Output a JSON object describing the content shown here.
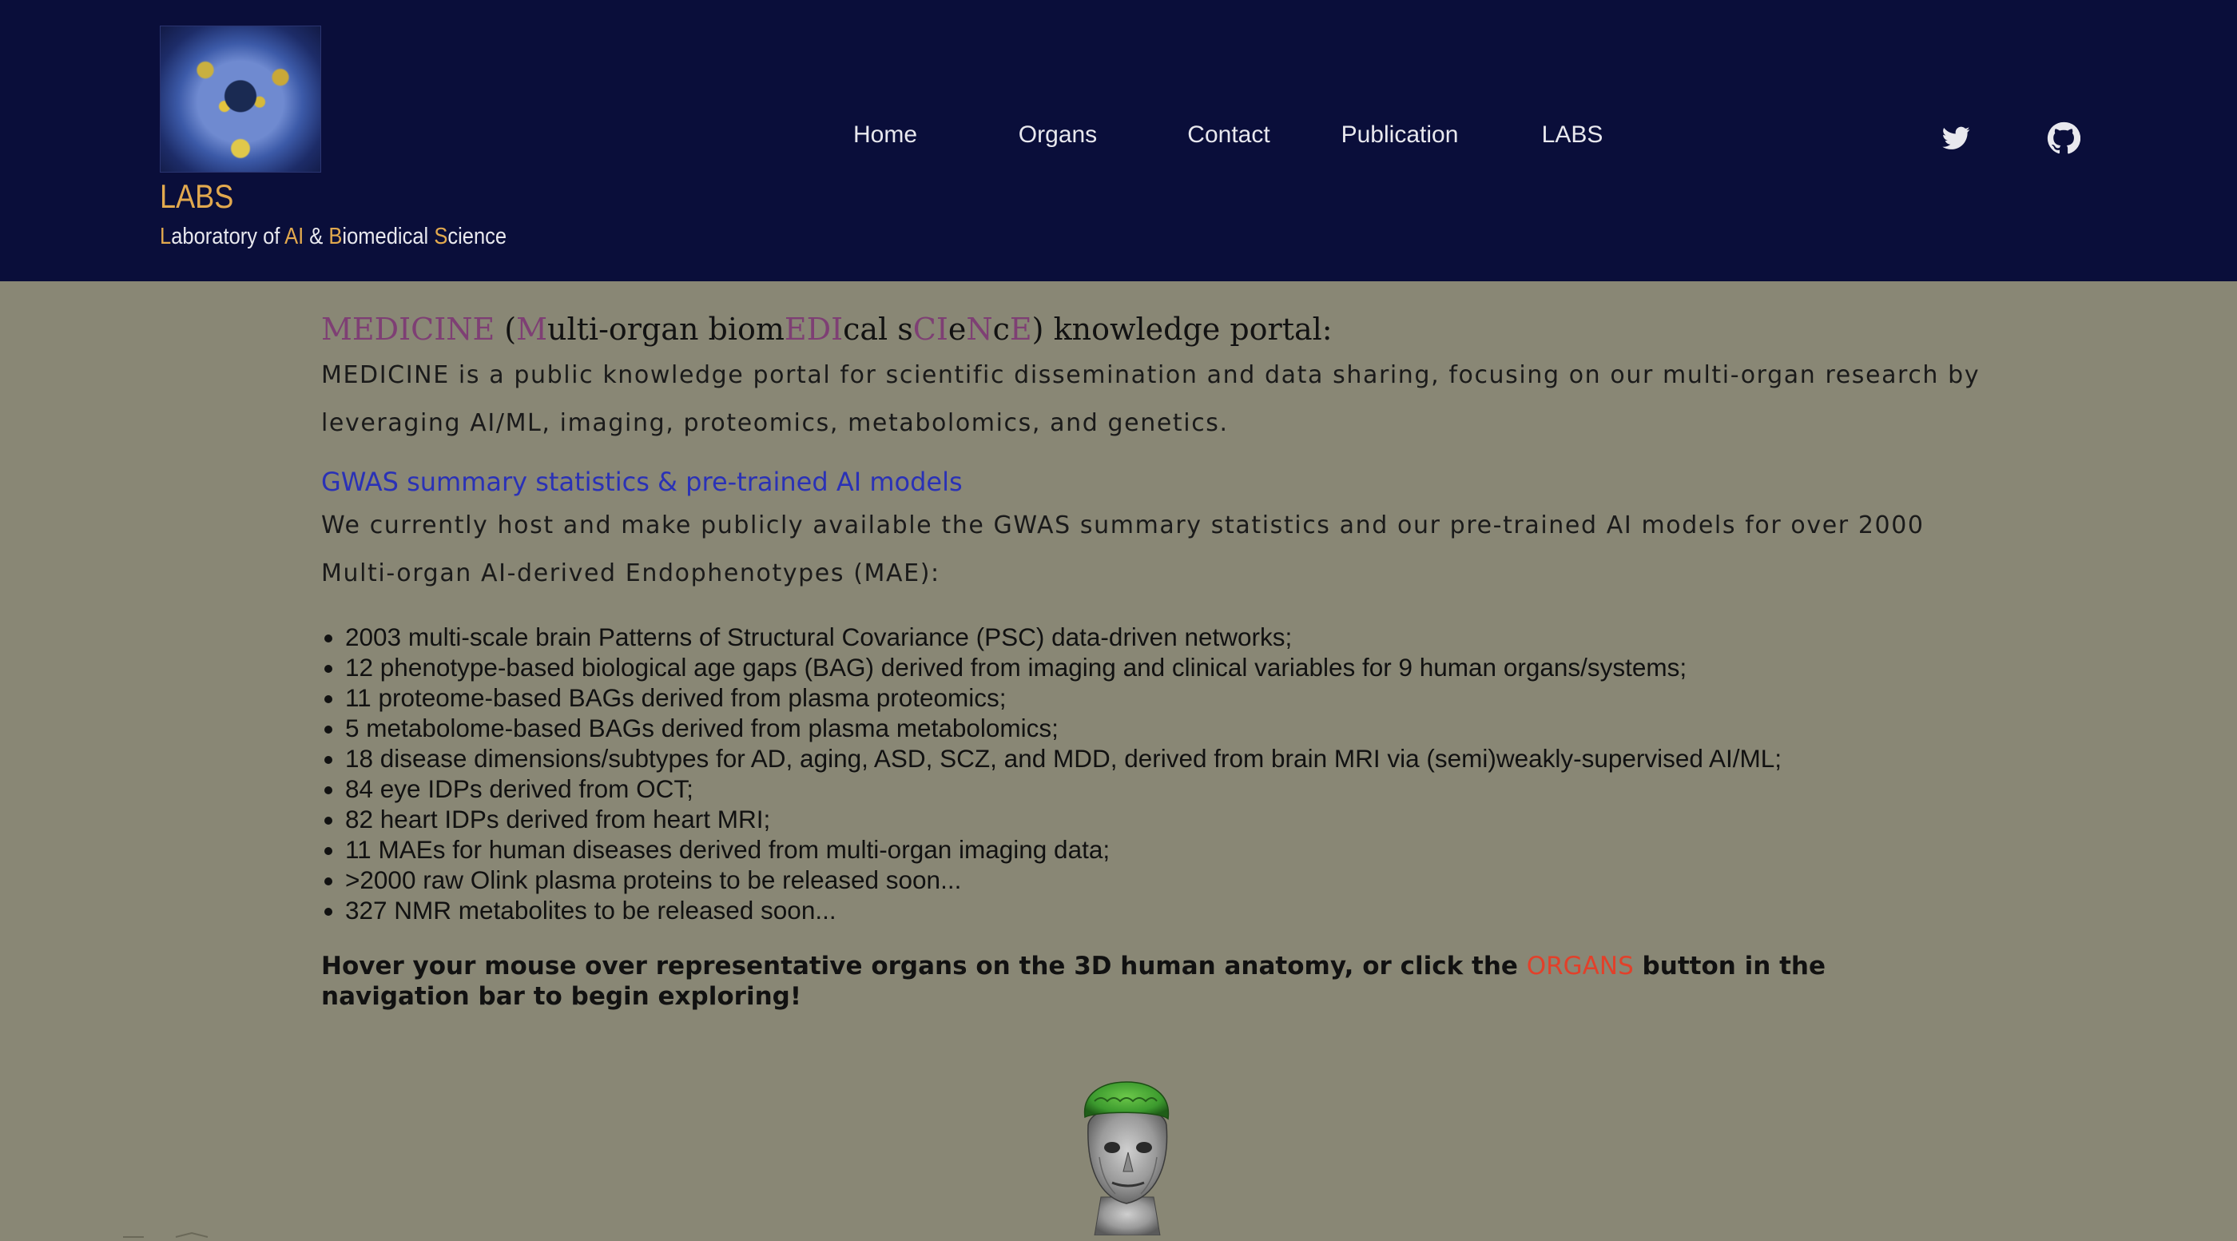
{
  "header": {
    "logo_title": "LABS",
    "logo_subtitle_parts": [
      {
        "text": "L",
        "hl": true
      },
      {
        "text": "aboratory of ",
        "hl": false
      },
      {
        "text": "AI",
        "hl": true
      },
      {
        "text": " & ",
        "hl": false
      },
      {
        "text": "B",
        "hl": true
      },
      {
        "text": "iomedical ",
        "hl": false
      },
      {
        "text": "S",
        "hl": true
      },
      {
        "text": "cience",
        "hl": false
      }
    ],
    "nav": [
      "Home",
      "Organs",
      "Contact",
      "Publication",
      "LABS"
    ],
    "social_icons": [
      "twitter-icon",
      "github-icon"
    ]
  },
  "main": {
    "heading_parts": [
      {
        "text": "MEDICINE",
        "acc": true
      },
      {
        "text": " (",
        "acc": false
      },
      {
        "text": "M",
        "acc": true
      },
      {
        "text": "ulti-organ biom",
        "acc": false
      },
      {
        "text": "EDI",
        "acc": true
      },
      {
        "text": "cal s",
        "acc": false
      },
      {
        "text": "CI",
        "acc": true
      },
      {
        "text": "e",
        "acc": false
      },
      {
        "text": "N",
        "acc": true
      },
      {
        "text": "c",
        "acc": false
      },
      {
        "text": "E",
        "acc": true
      },
      {
        "text": ") knowledge portal:",
        "acc": false
      }
    ],
    "intro_line1": "MEDICINE is a public knowledge portal for scientific dissemination and data sharing, focusing on our multi-organ research by",
    "intro_line2": "leveraging AI/ML, imaging, proteomics, metabolomics, and genetics.",
    "gwas_heading": "GWAS summary statistics & pre-trained AI models",
    "gwas_line1": "We currently host and make publicly available the GWAS summary statistics and our pre-trained AI models for over 2000",
    "gwas_line2": "Multi-organ AI-derived Endophenotypes (MAE):",
    "items": [
      "2003 multi-scale brain Patterns of Structural Covariance (PSC) data-driven networks;",
      "12 phenotype-based biological age gaps (BAG) derived from imaging and clinical variables for 9 human organs/systems;",
      "11 proteome-based BAGs derived from plasma proteomics;",
      "5 metabolome-based BAGs derived from plasma metabolomics;",
      "18 disease dimensions/subtypes for AD, aging, ASD, SCZ, and MDD, derived from brain MRI via (semi)weakly-supervised AI/ML;",
      "84 eye IDPs derived from OCT;",
      "82 heart IDPs derived from heart MRI;",
      "11 MAEs for human diseases derived from multi-organ imaging data;",
      ">2000 raw Olink plasma proteins to be released soon...",
      "327 NMR metabolites to be released soon..."
    ],
    "hover_before": "Hover your mouse over representative organs on the 3D human anatomy, or click the ",
    "hover_organs": "ORGANS",
    "hover_after": " button in the navigation bar to begin exploring!"
  },
  "colors": {
    "header_bg": "#0a0e3a",
    "page_bg": "#898775",
    "logo_accent": "#e2a94e",
    "heading_accent": "#7e3f74",
    "link_blue": "#2a31b6",
    "organs_red": "#e2402a",
    "brain_green": "#3c9a2e"
  }
}
